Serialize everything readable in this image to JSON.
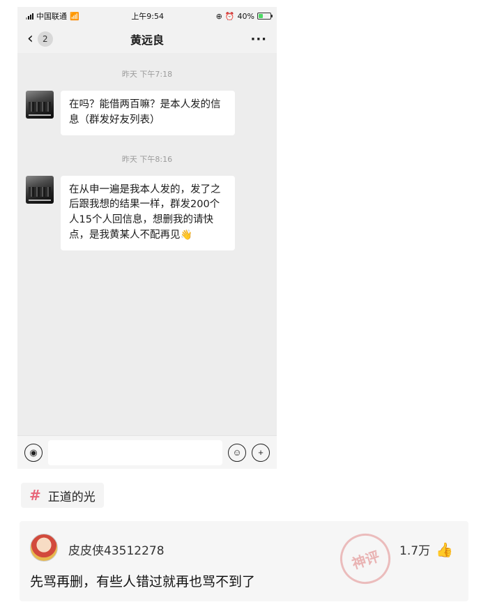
{
  "status_bar": {
    "carrier": "中国联通",
    "time": "上午9:54",
    "battery": "40%",
    "battery_level": 0.4
  },
  "nav": {
    "unread": "2",
    "title": "黄远良",
    "more": "···"
  },
  "messages": [
    {
      "timestamp": "昨天 下午7:18",
      "text": "在吗？能借两百嘛？是本人发的信息（群发好友列表）"
    },
    {
      "timestamp": "昨天 下午8:16",
      "text": "在从申一遍是我本人发的，发了之后跟我想的结果一样，群发200个人15个人回信息，想删我的请快点，是我黄某人不配再见",
      "emoji": "👋"
    }
  ],
  "topic": {
    "label": "正道的光"
  },
  "comment": {
    "username": "皮皮侠43512278",
    "likes": "1.7万",
    "text": "先骂再删，有些人错过就再也骂不到了",
    "stamp": "神评"
  },
  "colors": {
    "chat_bg": "#ededed",
    "topic_hash": "#e8667a"
  }
}
